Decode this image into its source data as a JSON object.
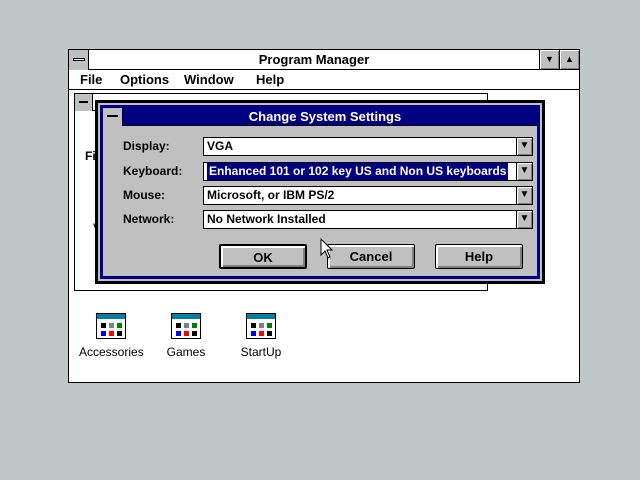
{
  "program_manager": {
    "title": "Program Manager",
    "menu": [
      "File",
      "Options",
      "Window",
      "Help"
    ],
    "minimize_icon": "down-arrow",
    "maximize_icon": "up-arrow"
  },
  "group_window": {
    "fragment_file": "Fil",
    "fragment_v": "V"
  },
  "program_icons": [
    {
      "label": "Accessories",
      "icon": "program-group-icon"
    },
    {
      "label": "Games",
      "icon": "program-group-icon"
    },
    {
      "label": "StartUp",
      "icon": "program-group-icon"
    }
  ],
  "dialog": {
    "title": "Change System Settings",
    "fields": [
      {
        "label": "Display:",
        "value": "VGA"
      },
      {
        "label": "Keyboard:",
        "value": "Enhanced 101 or 102 key US and Non US keyboards"
      },
      {
        "label": "Mouse:",
        "value": "Microsoft, or IBM PS/2"
      },
      {
        "label": "Network:",
        "value": "No Network Installed"
      }
    ],
    "buttons": {
      "ok": "OK",
      "cancel": "Cancel",
      "help": "Help"
    },
    "dropdown_icon": "down-arrow"
  },
  "colors": {
    "desktop": "#c0c7c8",
    "dialog_title": "#000080",
    "dialog_face": "#c0c0c0",
    "selection": "#000080"
  }
}
